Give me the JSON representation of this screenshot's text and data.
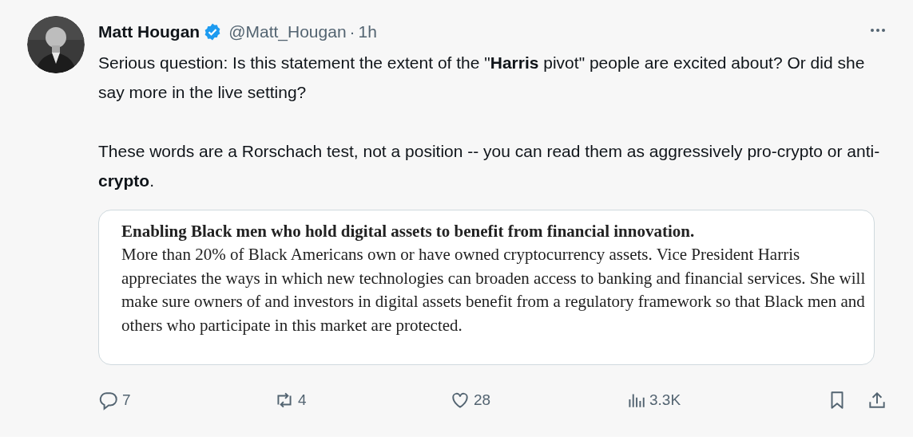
{
  "post": {
    "author": {
      "name": "Matt Hougan",
      "verified": true,
      "handle": "@Matt_Hougan",
      "separator": "·",
      "time": "1h"
    },
    "text": [
      "Serious question: Is this statement the extent of the \"**Harris** pivot\" people are excited about? Or did she say more in the live setting?",
      "These words are a Rorschach test, not a position -- you can read them as aggressively pro-crypto or anti-**crypto**."
    ],
    "attachment": {
      "heading": "Enabling Black men who hold digital assets to benefit from financial innovation.",
      "body": "More than 20% of Black Americans own or have owned cryptocurrency assets. Vice President Harris appreciates the ways in which new technologies can broaden access to banking and financial services. She will make sure owners of and investors in digital assets benefit from a regulatory framework so that Black men and others who participate in this market are protected."
    },
    "actions": [
      {
        "kind": "reply",
        "count": "7"
      },
      {
        "kind": "repost",
        "count": "4"
      },
      {
        "kind": "like",
        "count": "28"
      },
      {
        "kind": "views",
        "count": "3.3K"
      },
      {
        "kind": "bookmark"
      },
      {
        "kind": "share"
      }
    ]
  }
}
